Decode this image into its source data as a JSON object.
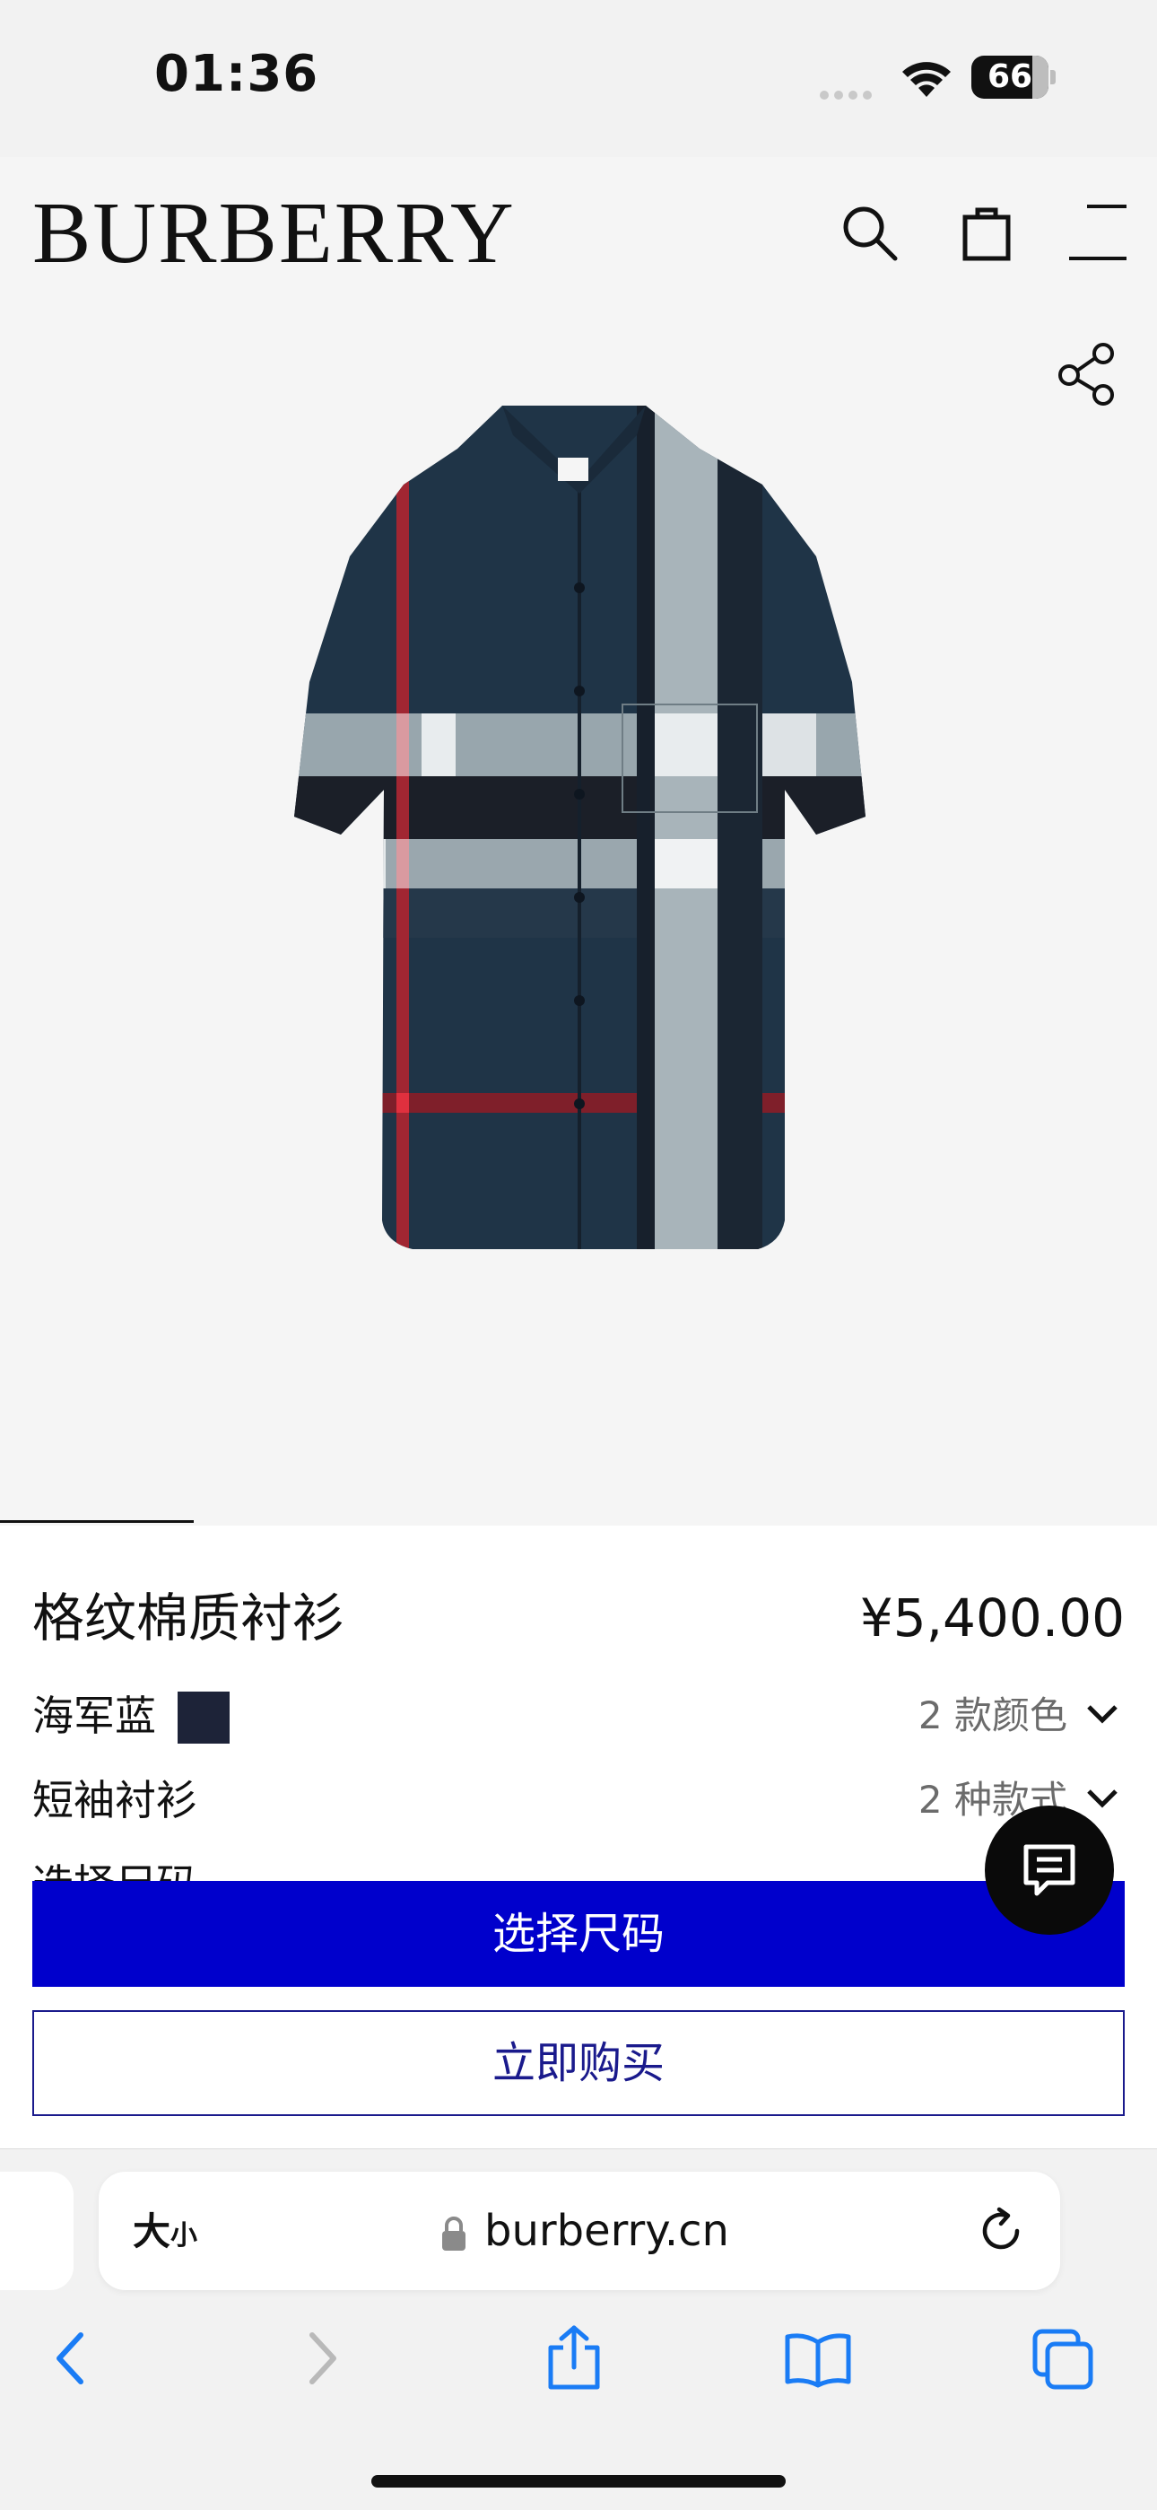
{
  "status_bar": {
    "time": "01:36",
    "battery": "66"
  },
  "header": {
    "brand": "BURBERRY"
  },
  "product": {
    "title": "格纹棉质衬衫",
    "price": "¥5,400.00",
    "color_name": "海军蓝",
    "color_swatch_hex": "#1d2338",
    "color_count": "2 款颜色",
    "style_name": "短袖衬衫",
    "style_count": "2 种款式",
    "size_label": "选择尺码"
  },
  "actions": {
    "select_size": "选择尺码",
    "buy_now": "立即购买"
  },
  "browser": {
    "text_size_big": "大",
    "text_size_small": "小",
    "url": "burberry.cn"
  },
  "colors": {
    "accent_blue": "#0000cc",
    "outline_blue": "#1a1a8c"
  },
  "icons": [
    "search-icon",
    "shopping-bag-icon",
    "menu-icon",
    "share-icon",
    "chat-icon",
    "lock-icon",
    "reload-icon",
    "back-icon",
    "forward-icon",
    "share-sheet-icon",
    "bookmarks-icon",
    "tabs-icon"
  ]
}
